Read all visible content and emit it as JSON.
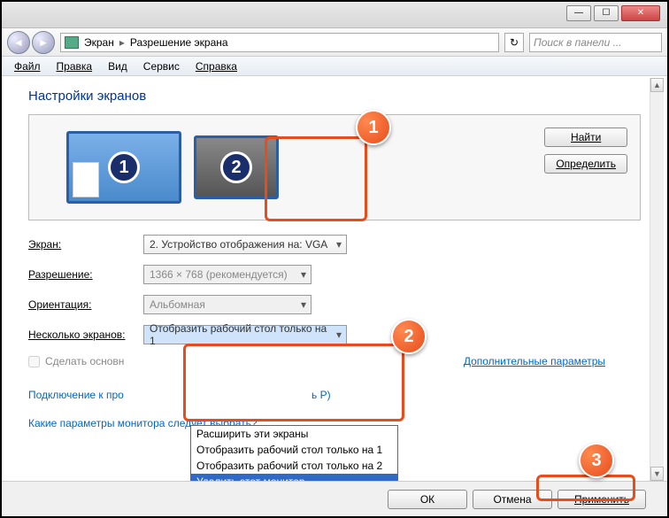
{
  "window": {
    "breadcrumb": [
      "Экран",
      "Разрешение экрана"
    ],
    "search_placeholder": "Поиск в панели ..."
  },
  "menu": {
    "file": "Файл",
    "edit": "Правка",
    "view": "Вид",
    "tools": "Сервис",
    "help": "Справка"
  },
  "page": {
    "title": "Настройки экранов",
    "find_btn": "Найти",
    "identify_btn": "Определить",
    "monitor1_num": "1",
    "monitor2_num": "2"
  },
  "form": {
    "screen_label": "Экран:",
    "screen_value": "2. Устройство отображения на: VGA",
    "resolution_label": "Разрешение:",
    "resolution_value": "1366 × 768 (рекомендуется)",
    "orientation_label": "Ориентация:",
    "orientation_value": "Альбомная",
    "multi_label": "Несколько экранов:",
    "multi_value": "Отобразить рабочий стол только на 1",
    "multi_options": [
      "Расширить эти экраны",
      "Отобразить рабочий стол только на 1",
      "Отобразить рабочий стол только на 2",
      "Удалить этот монитор"
    ],
    "primary_checkbox": "Сделать основн",
    "advanced_link": "Дополнительные параметры"
  },
  "links": {
    "projector": "Подключение к про",
    "projector_hint": "ь P)",
    "which_monitor": "Какие параметры монитора следует выбрать?"
  },
  "footer": {
    "ok": "ОК",
    "cancel": "Отмена",
    "apply": "Применить"
  },
  "callouts": {
    "c1": "1",
    "c2": "2",
    "c3": "3"
  }
}
